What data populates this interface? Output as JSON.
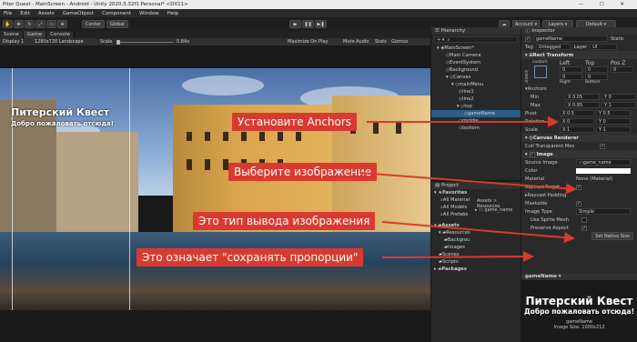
{
  "titlebar": {
    "title": "Piter Quest - MainScreen - Android - Unity 2020.3.32f1 Personal* <DX11>"
  },
  "menu": [
    "File",
    "Edit",
    "Assets",
    "GameObject",
    "Component",
    "Window",
    "Help"
  ],
  "toolbar": {
    "center": "Center",
    "global": "Global",
    "account": "Account",
    "layers": "Layers",
    "layout": "Default"
  },
  "tabs": {
    "scene": "Scene",
    "game": "Game",
    "console": "Console"
  },
  "gamebar": {
    "display": "Display 1",
    "resolution": "1280x720 Landscape",
    "scale_label": "Scale",
    "scale_value": "0.84x",
    "maximize": "Maximize On Play",
    "mute": "Mute Audio",
    "stats": "Stats",
    "gizmos": "Gizmos"
  },
  "overlay": {
    "title": "Питерский Квест",
    "subtitle": "Добро пожаловать отсюда!"
  },
  "callouts": {
    "anchors": "Установите Anchors",
    "image": "Выберите изображение",
    "type": "Это тип вывода изображения",
    "aspect": "Это означает \"сохранять пропорции\""
  },
  "hierarchy": {
    "title": "Hierarchy",
    "items": [
      "MainScreen*",
      "Main Camera",
      "EventSystem",
      "Background",
      "Canvas",
      "mainMenu",
      "line1",
      "line2",
      "top",
      "gameName",
      "middle",
      "bottom"
    ]
  },
  "project": {
    "title": "Project",
    "favorites": "Favorites",
    "fav_items": [
      "All Material",
      "All Models",
      "All Prefabs"
    ],
    "assets": "Assets",
    "tree": [
      "Resources",
      "Backgrou",
      "Images",
      "Scenes",
      "Scripts"
    ],
    "packages": "Packages",
    "breadcrumb": "Assets > Resources",
    "file": "game_name"
  },
  "inspector": {
    "title": "Inspector",
    "object_name": "gameName",
    "static": "Static",
    "tag": "Untagged",
    "layer": "UI",
    "rect_transform": "Rect Transform",
    "custom": "custom",
    "stretch": "stretch",
    "left": "Left",
    "top": "Top",
    "posz": "Pos Z",
    "right": "Right",
    "bottom": "Bottom",
    "left_v": "0",
    "top_v": "0",
    "posz_v": "0",
    "right_v": "0",
    "bottom_v": "0",
    "anchors": "Anchors",
    "min": "Min",
    "max": "Max",
    "min_x": "X 0.05",
    "min_y": "Y 0",
    "max_x": "X 0.95",
    "max_y": "Y 1",
    "pivot": "Pivot",
    "pivot_x": "X 0.5",
    "pivot_y": "Y 0.5",
    "rotation": "Rotation",
    "rot_x": "X 0",
    "rot_y": "Y 0",
    "scale": "Scale",
    "scale_x": "X 1",
    "scale_y": "Y 1",
    "canvas_renderer": "Canvas Renderer",
    "cull": "Cull Transparent Mes",
    "image": "Image",
    "source_image": "Source Image",
    "source_value": "game_name",
    "color": "Color",
    "material": "Material",
    "material_value": "None (Material)",
    "raycast_target": "Raycast Target",
    "raycast_padding": "Raycast Padding",
    "maskable": "Maskable",
    "image_type": "Image Type",
    "image_type_value": "Simple",
    "use_sprite_mesh": "Use Sprite Mesh",
    "preserve_aspect": "Preserve Aspect",
    "set_native": "Set Native Size"
  },
  "preview": {
    "name": "gameName",
    "footer_name": "gameName",
    "footer_size": "Image Size: 1000x212"
  },
  "colors": {
    "accent": "#d93a2f",
    "selection": "#2c5d87"
  }
}
